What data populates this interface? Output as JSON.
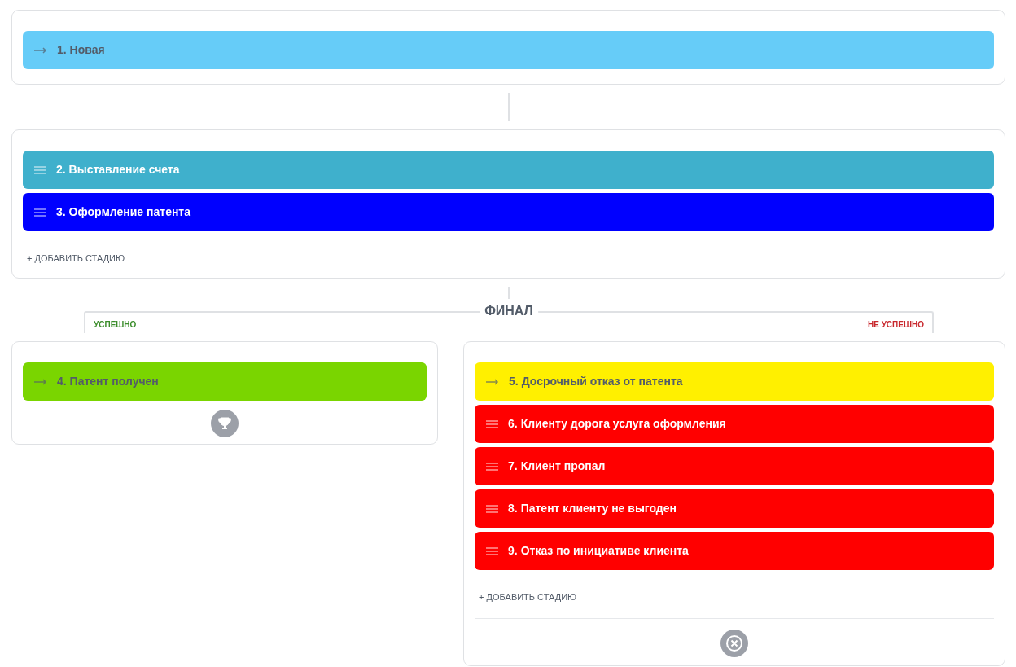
{
  "start_group": {
    "stages": [
      {
        "kind": "fixed",
        "title": "1. Новая",
        "color": "#66ccf8"
      }
    ]
  },
  "work_group": {
    "stages": [
      {
        "kind": "draggable",
        "title": "2. Выставление счета",
        "color": "#3fb0cc"
      },
      {
        "kind": "draggable",
        "title": "3. Оформление патента",
        "color": "#0000ff"
      }
    ],
    "add_label": "+ ДОБАВИТЬ СТАДИЮ"
  },
  "final": {
    "title": "ФИНАЛ",
    "success_label": "УСПЕШНО",
    "failure_label": "НЕ УСПЕШНО"
  },
  "success_group": {
    "stages": [
      {
        "kind": "fixed",
        "title": "4. Патент получен",
        "color": "#7ad500"
      }
    ]
  },
  "failure_group": {
    "stages": [
      {
        "kind": "fixed",
        "title": "5. Досрочный отказ от патента",
        "color": "#fff000"
      },
      {
        "kind": "draggable",
        "title": "6. Клиенту дорога услуга оформления",
        "color": "#ff0000"
      },
      {
        "kind": "draggable",
        "title": "7. Клиент пропал",
        "color": "#ff0000"
      },
      {
        "kind": "draggable",
        "title": "8. Патент клиенту не выгоден",
        "color": "#ff0000"
      },
      {
        "kind": "draggable",
        "title": "9. Отказ по инициативе клиента",
        "color": "#ff0000"
      }
    ],
    "add_label": "+ ДОБАВИТЬ СТАДИЮ"
  }
}
